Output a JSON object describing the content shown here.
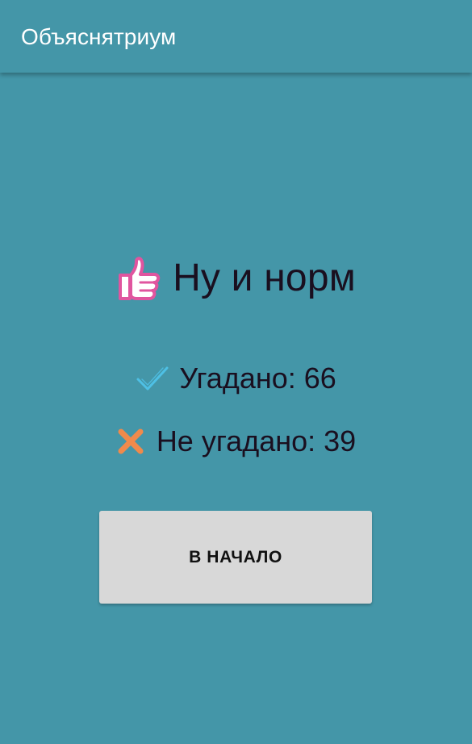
{
  "app_bar": {
    "title": "Объяснятриум"
  },
  "result": {
    "title": "Ну и норм",
    "icon": "thumbs-up-icon"
  },
  "stats": {
    "guessed_label": "Угадано: 66",
    "guessed_icon": "check-icon",
    "missed_label": "Не угадано: 39",
    "missed_icon": "cross-icon"
  },
  "actions": {
    "home_label": "В НАЧАЛО"
  },
  "colors": {
    "background": "#4496a8",
    "button": "#d8d8d8",
    "check": "#4ec0e5",
    "cross": "#f08a4b",
    "thumb_outline": "#e0559f"
  }
}
